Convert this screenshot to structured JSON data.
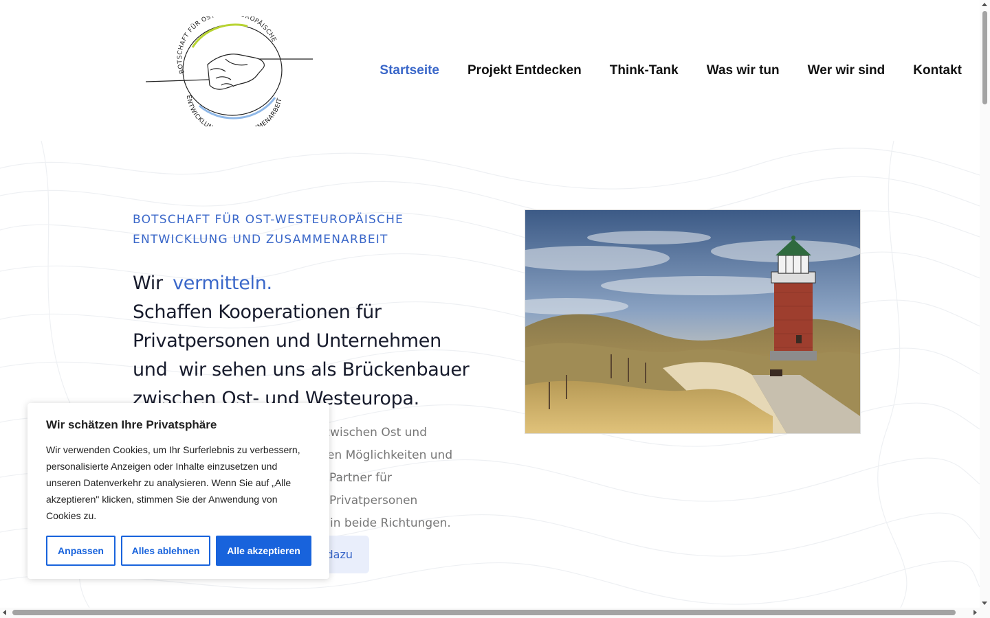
{
  "header": {
    "logo": {
      "text_top": "BOTSCHAFT FÜR OST-WESTEUROPÄISCHE",
      "text_bottom": "ENTWICKLUNG UND ZUSAMMENARBEIT"
    },
    "nav": [
      {
        "label": "Startseite",
        "active": true
      },
      {
        "label": "Projekt Entdecken"
      },
      {
        "label": "Think-Tank"
      },
      {
        "label": "Was wir tun"
      },
      {
        "label": "Wer wir sind"
      },
      {
        "label": "Kontakt"
      }
    ]
  },
  "hero": {
    "eyebrow_line1": "BOTSCHAFT FÜR OST-WESTEUROPÄISCHE",
    "eyebrow_line2": "ENTWICKLUNG UND ZUSAMMENARBEIT",
    "headline_lead": "Wir",
    "headline_accent": "vermitteln.",
    "headline_line2": "Schaffen Kooperationen für",
    "headline_line3": "Privatpersonen und Unternehmen",
    "headline_line4": "und  wir sehen uns als Brückenbauer",
    "headline_line5": "zwischen Ost- und Westeuropa.",
    "desc_line1": "n zwischen Ost und",
    "desc_line2": "en Möglichkeiten und",
    "desc_line3": "Partner für Privatpersonen",
    "desc_line4": "in beide Richtungen.",
    "cta_label": "dazu"
  },
  "cookie": {
    "title": "Wir schätzen Ihre Privatsphäre",
    "text": "Wir verwenden Cookies, um Ihr Surferlebnis zu verbessern, personalisierte Anzeigen oder Inhalte einzusetzen und unseren Datenverkehr zu analysieren. Wenn Sie auf „Alle akzeptieren\" klicken, stimmen Sie der Anwendung von Cookies zu.",
    "btn_customize": "Anpassen",
    "btn_reject": "Alles ablehnen",
    "btn_accept": "Alle akzeptieren"
  },
  "colors": {
    "accent": "#3a67c9",
    "cookie_primary": "#1863dc",
    "headline": "#171b2c"
  }
}
